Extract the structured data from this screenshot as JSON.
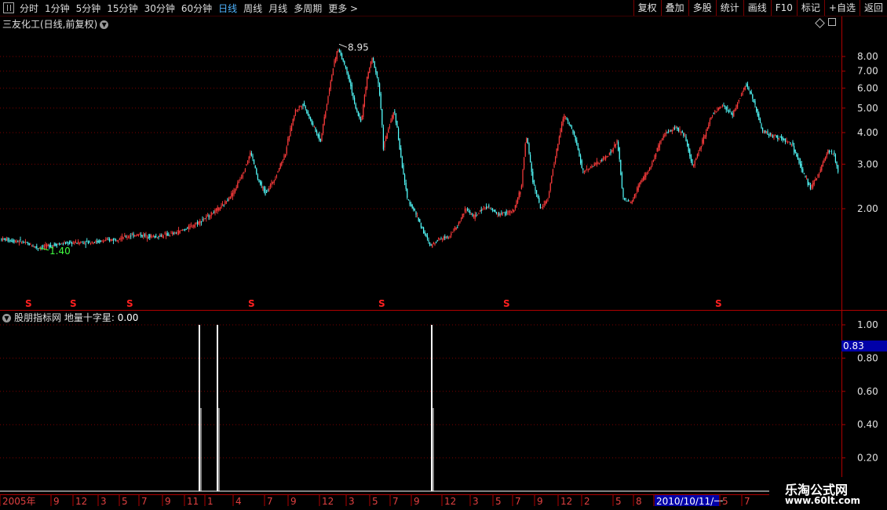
{
  "toolbar": {
    "periods": [
      "分时",
      "1分钟",
      "5分钟",
      "15分钟",
      "30分钟",
      "60分钟",
      "日线",
      "周线",
      "月线",
      "多周期",
      "更多 >"
    ],
    "active_period": "日线",
    "right_buttons": [
      "复权",
      "叠加",
      "多股",
      "统计",
      "画线",
      "F10",
      "标记",
      "+自选",
      "返回"
    ]
  },
  "stock_title": "三友化工(日线,前复权)",
  "main_chart": {
    "y_ticks": [
      "8.00",
      "7.00",
      "6.00",
      "5.00",
      "4.00",
      "3.00",
      "2.00"
    ],
    "y_values": [
      8,
      7,
      6,
      5,
      4,
      3,
      2
    ],
    "high_label": "8.95",
    "low_label": "1.40",
    "marker_label": "S",
    "colors": {
      "up": "#ff3c3c",
      "down": "#54ffff",
      "grid": "#7a0000",
      "marker": "#ff2020"
    }
  },
  "indicator": {
    "name": "股朋指标网",
    "formula": "地量十字星",
    "value": "0.00",
    "y_ticks": [
      "1.00",
      "0.80",
      "0.60",
      "0.40",
      "0.20"
    ],
    "y_values": [
      1.0,
      0.8,
      0.6,
      0.4,
      0.2
    ],
    "cursor_value": "0.83",
    "color": "#ffffff"
  },
  "date_axis": {
    "labels": [
      "2005年",
      "9",
      "12",
      "3",
      "5",
      "7",
      "9",
      "11",
      "1",
      "4",
      "7",
      "9",
      "12",
      "3",
      "5",
      "7",
      "9",
      "12",
      "3",
      "5",
      "7",
      "9",
      "12",
      "2",
      "5",
      "8",
      "2010/10/11/一",
      "5",
      "7"
    ],
    "highlight": "2010/10/11/一"
  },
  "watermark": {
    "line1": "乐淘公式网",
    "line2": "www.60lt.com"
  }
}
